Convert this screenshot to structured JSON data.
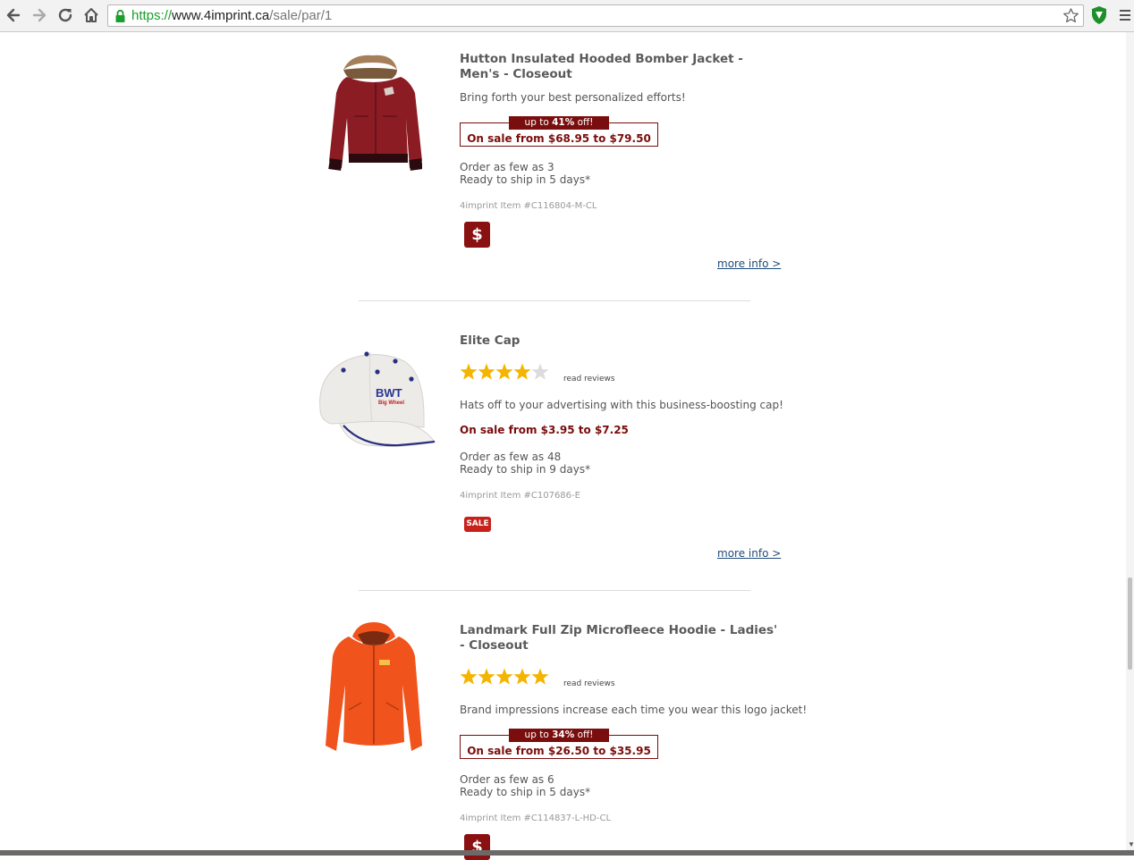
{
  "browser": {
    "url_scheme": "https://",
    "url_host": "www.4imprint.ca",
    "url_path": "/sale/par/1"
  },
  "products": [
    {
      "title": "Hutton Insulated Hooded Bomber Jacket - Men's - Closeout",
      "description": "Bring forth your best personalized efforts!",
      "sale_tag_prefix": "up to ",
      "sale_tag_percent": "41%",
      "sale_tag_suffix": " off!",
      "price": "On sale from $68.95 to $79.50",
      "min_order": "Order as few as 3",
      "ship": "Ready to ship in 5 days*",
      "item_no": "4imprint Item #C116804-M-CL",
      "badge": "$",
      "more_info": "more info >",
      "color": "#8b1c24"
    },
    {
      "title": "Elite Cap",
      "rating": 4,
      "read_reviews": "read reviews",
      "description": "Hats off to your advertising with this business-boosting cap!",
      "price": "On sale from $3.95 to $7.25",
      "min_order": "Order as few as 48",
      "ship": "Ready to ship in 9 days*",
      "item_no": "4imprint Item #C107686-E",
      "badge": "SALE",
      "more_info": "more info >",
      "logo_text": "BWT",
      "logo_subtext": "Big Wheel"
    },
    {
      "title": "Landmark Full Zip Microfleece Hoodie - Ladies' - Closeout",
      "rating": 5,
      "read_reviews": "read reviews",
      "description": "Brand impressions increase each time you wear this logo jacket!",
      "sale_tag_prefix": "up to ",
      "sale_tag_percent": "34%",
      "sale_tag_suffix": " off!",
      "price": "On sale from $26.50 to $35.95",
      "min_order": "Order as few as 6",
      "ship": "Ready to ship in 5 days*",
      "item_no": "4imprint Item #C114837-L-HD-CL",
      "badge": "$",
      "color": "#f0531c"
    }
  ]
}
